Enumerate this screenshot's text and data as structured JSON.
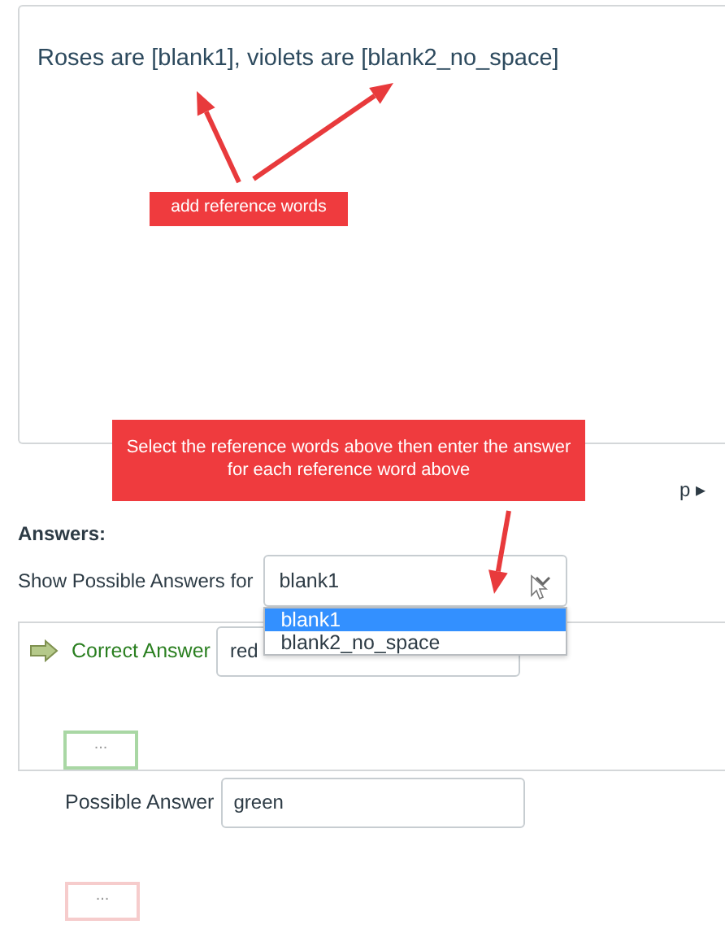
{
  "editor": {
    "text": "Roses are [blank1], violets are [blank2_no_space]"
  },
  "callouts": [
    {
      "text": "add reference words"
    },
    {
      "text": "Select the reference words above then enter the answer for each reference word above"
    }
  ],
  "toolbar": {
    "text": "p ▸"
  },
  "answers": {
    "heading": "Answers:",
    "show_label": "Show Possible Answers for",
    "select": {
      "value": "blank1",
      "expanded": true,
      "options": [
        {
          "label": "blank1",
          "selected": true
        },
        {
          "label": "blank2_no_space",
          "selected": false
        }
      ]
    },
    "entries": [
      {
        "kind": "correct",
        "label": "Correct Answer",
        "value": "red",
        "more": "..."
      },
      {
        "kind": "possible",
        "label": "Possible Answer",
        "value": "green",
        "more": "..."
      }
    ]
  }
}
